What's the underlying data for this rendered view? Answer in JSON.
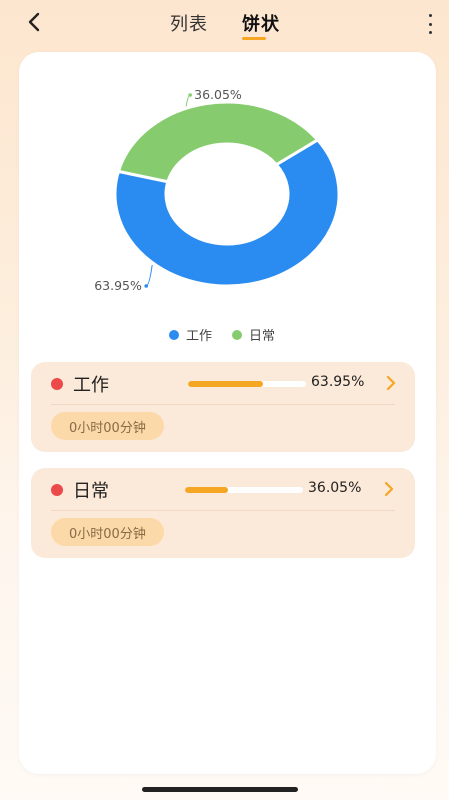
{
  "header": {
    "tabs": [
      {
        "label": "列表",
        "active": false
      },
      {
        "label": "饼状",
        "active": true
      }
    ]
  },
  "chart_data": {
    "type": "pie",
    "style": "donut",
    "title": "",
    "slices": [
      {
        "name": "工作",
        "value": 63.95,
        "label": "63.95%",
        "color": "#2a8cf0"
      },
      {
        "name": "日常",
        "value": 36.05,
        "label": "36.05%",
        "color": "#86cc6e"
      }
    ],
    "legend_position": "bottom"
  },
  "legend": [
    {
      "label": "工作",
      "color": "#2a8cf0"
    },
    {
      "label": "日常",
      "color": "#86cc6e"
    }
  ],
  "categories": [
    {
      "name": "工作",
      "percent_label": "63.95%",
      "progress": 0.6395,
      "duration": "0小时00分钟"
    },
    {
      "name": "日常",
      "percent_label": "36.05%",
      "progress": 0.3605,
      "duration": "0小时00分钟"
    }
  ],
  "colors": {
    "accent": "#f5a623",
    "bullet": "#ec4a4a",
    "work": "#2a8cf0",
    "daily": "#86cc6e"
  }
}
